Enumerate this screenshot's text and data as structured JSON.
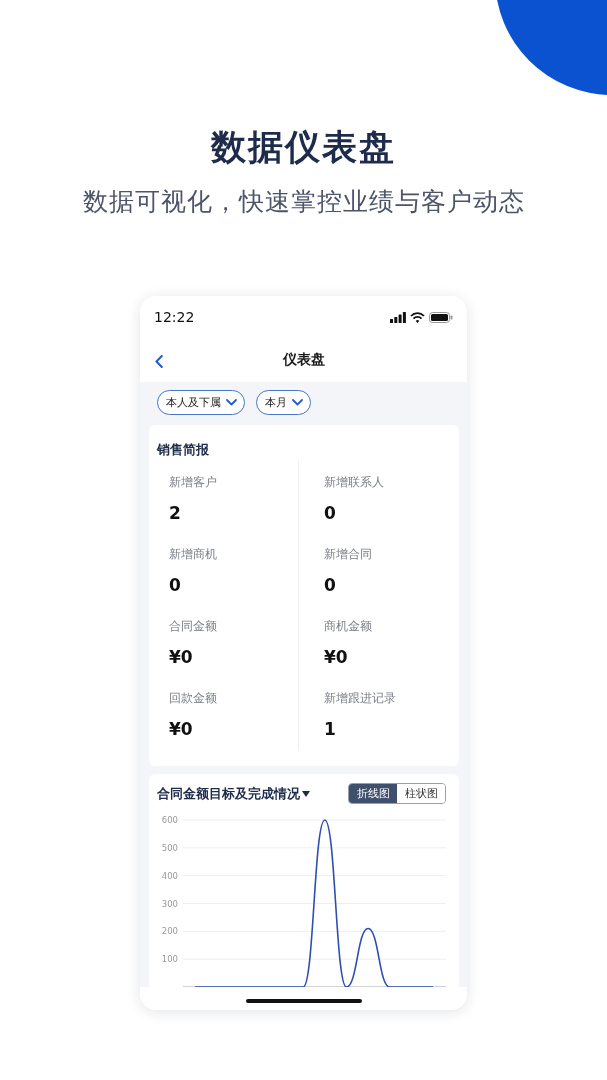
{
  "header": {
    "title": "数据仪表盘",
    "subtitle": "数据可视化，快速掌控业绩与客户动态"
  },
  "phone": {
    "status_bar": {
      "time": "12:22"
    },
    "nav_bar": {
      "title": "仪表盘"
    },
    "filters": [
      {
        "label": "本人及下属"
      },
      {
        "label": "本月"
      }
    ],
    "sales_summary": {
      "title": "销售简报",
      "stats": [
        {
          "label": "新增客户",
          "value": "2"
        },
        {
          "label": "新增联系人",
          "value": "0"
        },
        {
          "label": "新增商机",
          "value": "0"
        },
        {
          "label": "新增合同",
          "value": "0"
        },
        {
          "label": "合同金额",
          "value": "¥0"
        },
        {
          "label": "商机金额",
          "value": "¥0"
        },
        {
          "label": "回款金额",
          "value": "¥0"
        },
        {
          "label": "新增跟进记录",
          "value": "1"
        }
      ]
    },
    "contract_chart": {
      "title": "合同金额目标及完成情况",
      "view_toggle": [
        {
          "label": "折线图",
          "selected": true
        },
        {
          "label": "柱状图",
          "selected": false
        }
      ],
      "chart_data": {
        "type": "line",
        "values": [
          0,
          0,
          0,
          0,
          0,
          0,
          600,
          0,
          210,
          0,
          0,
          0
        ],
        "ylim": [
          0,
          600
        ],
        "yticks": [
          100,
          200,
          300,
          400,
          500,
          600
        ],
        "grid": true
      }
    }
  }
}
